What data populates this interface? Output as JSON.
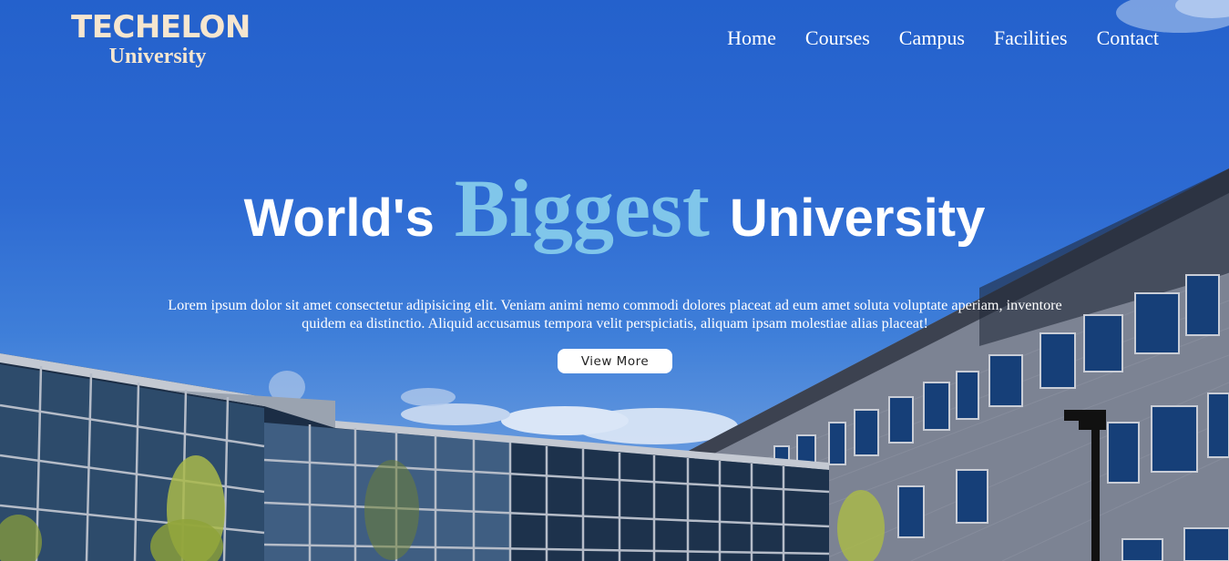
{
  "header": {
    "logo_line1": "TECHELON",
    "logo_line2": "University",
    "nav": [
      {
        "label": "Home"
      },
      {
        "label": "Courses"
      },
      {
        "label": "Campus"
      },
      {
        "label": "Facilities"
      },
      {
        "label": "Contact"
      }
    ]
  },
  "hero": {
    "title_word1": "World's",
    "title_highlight": "Biggest",
    "title_word3": "University",
    "text": "Lorem ipsum dolor sit amet consectetur adipisicing elit. Veniam animi nemo commodi dolores placeat ad eum amet soluta voluptate aperiam, inventore quidem ea distinctio. Aliquid accusamus tempora velit perspiciatis, aliquam ipsam molestiae alias placeat!",
    "button_label": "View More"
  },
  "colors": {
    "sky": "#2d6ad2",
    "logo": "#f6e6cf",
    "highlight": "#80c6ea",
    "nav_text": "#ffffff"
  }
}
